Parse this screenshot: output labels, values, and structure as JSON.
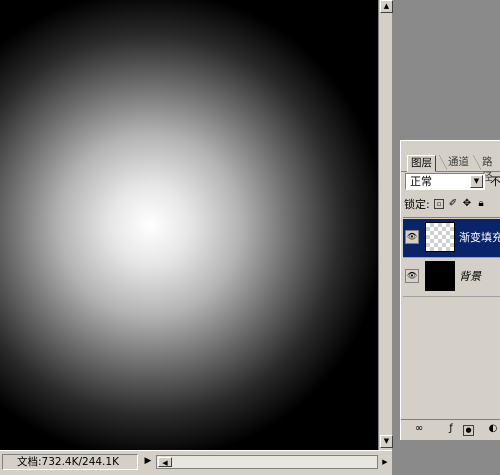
{
  "statusbar": {
    "doc_info": "文档:732.4K/244.1K",
    "play_glyph": "▶"
  },
  "layers_panel": {
    "tabs": [
      {
        "label": "图层",
        "active": true
      },
      {
        "label": "通道",
        "active": false
      },
      {
        "label": "路径",
        "active": false
      }
    ],
    "blend_mode": "正常",
    "opacity_label": "不",
    "lock_label": "锁定:",
    "lock_icons": [
      "lock-transparent-icon",
      "lock-paint-icon",
      "lock-move-icon",
      "lock-all-icon"
    ],
    "layers": [
      {
        "name": "渐变填充",
        "selected": true,
        "thumb": "transparent",
        "visible": true
      },
      {
        "name": "背景",
        "selected": false,
        "thumb": "black",
        "visible": true
      }
    ],
    "bottom_icons": [
      "link-icon",
      "layer-style-icon",
      "mask-icon",
      "adjustment-icon"
    ]
  },
  "colors": {
    "selection": "#0a246a",
    "panel_bg": "#d4d0c8",
    "workspace": "#8a8a8a"
  }
}
